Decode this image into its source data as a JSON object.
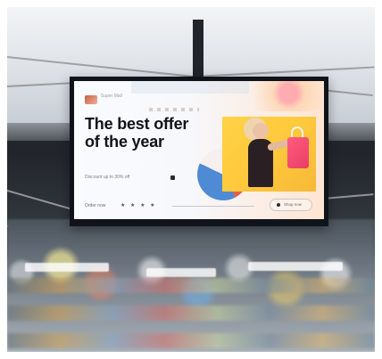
{
  "display": {
    "headline": "The best offer\nof the year",
    "subline": "Discount up to 30% off",
    "bottom_text": "Order now",
    "bottom_glyphs": "★ ★ ★ ★",
    "cta_text": "Shop now",
    "logo_text": "Super Mall"
  }
}
